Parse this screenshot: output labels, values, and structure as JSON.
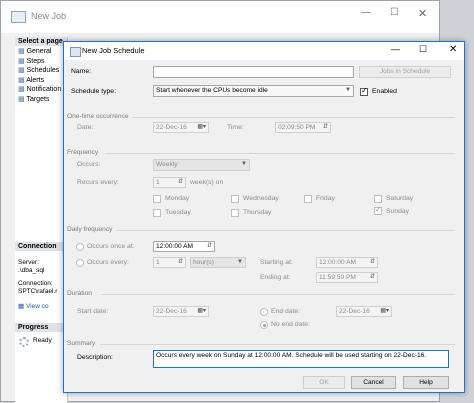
{
  "bg_window": {
    "title": "New Job",
    "select_page": "Select a page",
    "pages": [
      "General",
      "Steps",
      "Schedules",
      "Alerts",
      "Notification",
      "Targets"
    ],
    "connection_header": "Connection",
    "server_label": "Server:",
    "server_value": ".\\dba_sql",
    "connection_label": "Connection:",
    "connection_value": "SPTC\\rafael.r",
    "view_link": "View co",
    "progress_header": "Progress",
    "progress_status": "Ready"
  },
  "dialog": {
    "title": "New Job Schedule",
    "name_label": "Name:",
    "name_value": "",
    "jobs_button": "Jobs in Schedule",
    "schedule_type_label": "Schedule type:",
    "schedule_type_value": "Start whenever the CPUs become idle",
    "enabled_label": "Enabled",
    "one_time_group": "One-time occurrence",
    "date_label": "Date:",
    "date_value": "22-Dec-16",
    "time_label": "Time:",
    "time_value": "02:09:50 PM",
    "frequency_group": "Frequency",
    "occurs_label": "Occurs:",
    "occurs_value": "Weekly",
    "recurs_label": "Recurs every:",
    "recurs_value": "1",
    "recurs_unit": "week(s) on",
    "days": {
      "monday": "Monday",
      "wednesday": "Wednesday",
      "friday": "Friday",
      "saturday": "Saturday",
      "tuesday": "Tuesday",
      "thursday": "Thursday",
      "sunday": "Sunday"
    },
    "daily_group": "Daily frequency",
    "occurs_once_label": "Occurs once at:",
    "occurs_once_value": "12:00:00 AM",
    "occurs_every_label": "Occurs every:",
    "occurs_every_value": "1",
    "occurs_every_unit": "hour(s)",
    "starting_label": "Starting at:",
    "starting_value": "12:00:00 AM",
    "ending_label": "Ending at:",
    "ending_value": "11:59:59 PM",
    "duration_group": "Duration",
    "start_date_label": "Start date:",
    "start_date_value": "22-Dec-16",
    "end_date_label": "End date:",
    "end_date_value": "22-Dec-16",
    "no_end_label": "No end date:",
    "summary_group": "Summary",
    "description_label": "Description:",
    "description_value": "Occurs every week on Sunday at 12:00:00 AM. Schedule will be used starting on 22-Dec-16.",
    "ok_button": "OK",
    "cancel_button": "Cancel",
    "help_button": "Help"
  }
}
